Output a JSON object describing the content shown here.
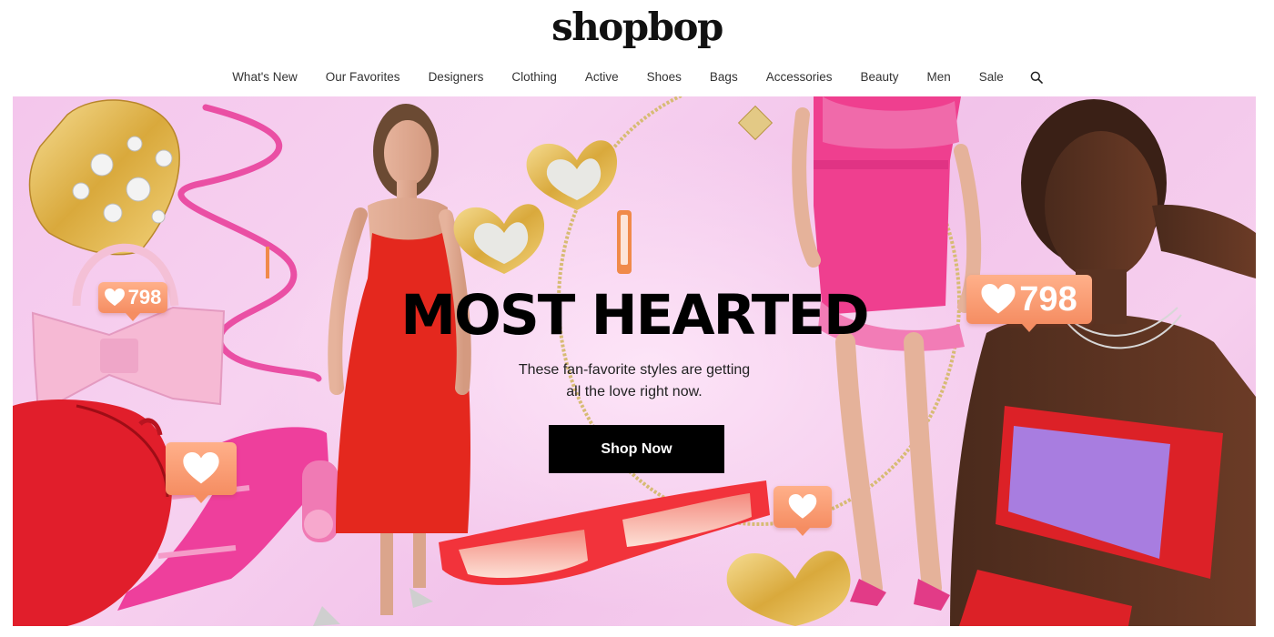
{
  "brand": {
    "logo_text": "shopbop"
  },
  "nav": {
    "items": [
      {
        "label": "What's New"
      },
      {
        "label": "Our Favorites"
      },
      {
        "label": "Designers"
      },
      {
        "label": "Clothing"
      },
      {
        "label": "Active"
      },
      {
        "label": "Shoes"
      },
      {
        "label": "Bags"
      },
      {
        "label": "Accessories"
      },
      {
        "label": "Beauty"
      },
      {
        "label": "Men"
      },
      {
        "label": "Sale"
      }
    ],
    "search_icon": "search-icon"
  },
  "hero": {
    "headline": "MOST HEARTED",
    "subcopy_line1": "These fan-favorite styles are getting",
    "subcopy_line2": "all the love right now.",
    "cta_label": "Shop Now",
    "badges": [
      {
        "icon": "heart-icon",
        "count": "798"
      },
      {
        "icon": "heart-icon",
        "count": "798"
      },
      {
        "icon": "heart-icon",
        "count": ""
      },
      {
        "icon": "heart-icon",
        "count": ""
      }
    ],
    "colors": {
      "background": "#f4c6ec",
      "badge": "#f58d62",
      "cta_background": "#000000",
      "cta_text": "#ffffff"
    }
  }
}
